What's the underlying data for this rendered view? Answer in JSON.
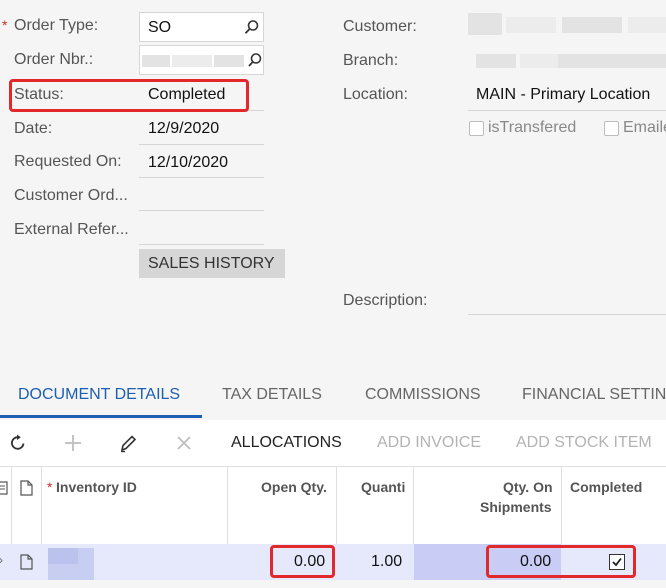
{
  "form": {
    "order_type": {
      "label": "Order Type:",
      "value": "SO"
    },
    "order_nbr": {
      "label": "Order Nbr.:"
    },
    "status": {
      "label": "Status:",
      "value": "Completed"
    },
    "date": {
      "label": "Date:",
      "value": "12/9/2020"
    },
    "requested_on": {
      "label": "Requested On:",
      "value": "12/10/2020"
    },
    "customer_order": {
      "label": "Customer Ord..."
    },
    "external_ref": {
      "label": "External Refer..."
    },
    "sales_history_label": "SALES HISTORY",
    "customer": {
      "label": "Customer:"
    },
    "branch": {
      "label": "Branch:"
    },
    "location": {
      "label": "Location:",
      "value": "MAIN - Primary Location"
    },
    "is_transfered_label": "isTransfered",
    "email_label": "Emaile",
    "description": {
      "label": "Description:"
    }
  },
  "tabs": [
    {
      "label": "DOCUMENT DETAILS",
      "active": true
    },
    {
      "label": "TAX DETAILS",
      "active": false
    },
    {
      "label": "COMMISSIONS",
      "active": false
    },
    {
      "label": "FINANCIAL SETTIN",
      "active": false
    }
  ],
  "toolbar": {
    "allocations": "ALLOCATIONS",
    "add_invoice": "ADD INVOICE",
    "add_stock_item": "ADD STOCK ITEM"
  },
  "grid": {
    "headers": {
      "inventory_id": "Inventory ID",
      "open_qty": "Open Qty.",
      "quantity": "Quanti",
      "qty_on_shipments_1": "Qty. On",
      "qty_on_shipments_2": "Shipments",
      "completed": "Completed"
    },
    "row": {
      "open_qty": "0.00",
      "quantity": "1.00",
      "qty_on_shipments": "0.00",
      "completed": true
    }
  },
  "colors": {
    "accent": "#1d5fb0",
    "highlight": "#e3282b",
    "row_selected": "#e6e8fb"
  }
}
